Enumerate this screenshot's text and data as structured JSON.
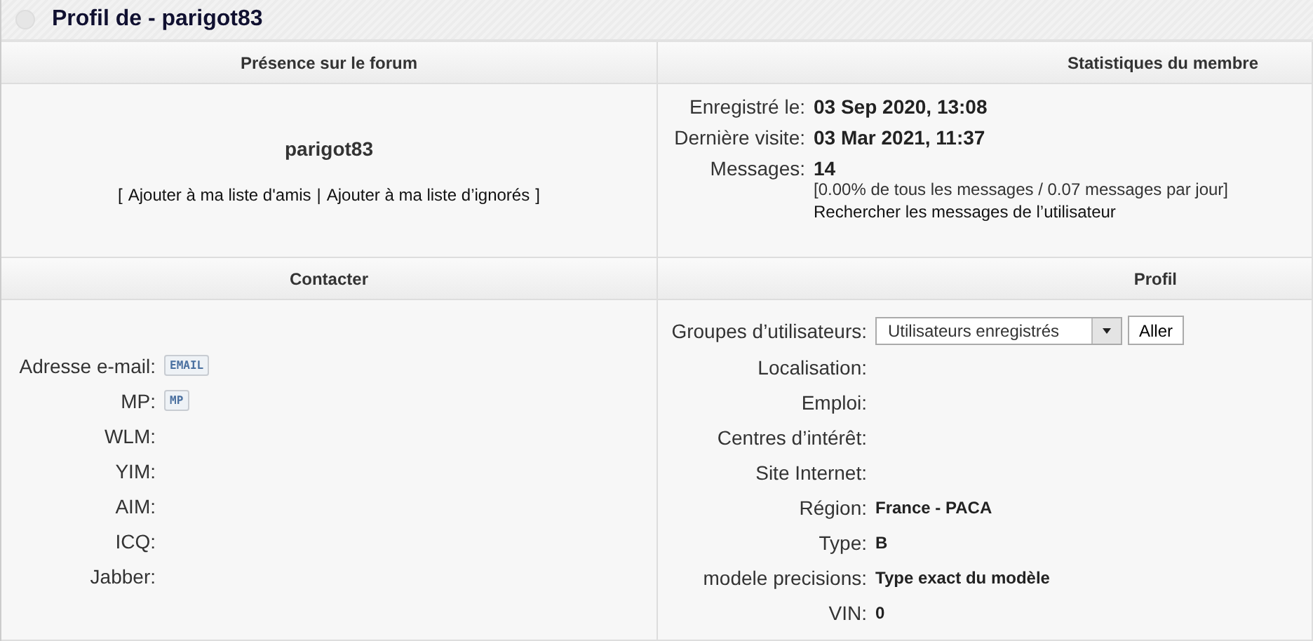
{
  "title": "Profil de - parigot83",
  "presence": {
    "heading": "Présence sur le forum",
    "username": "parigot83",
    "open_bracket": "[",
    "links": [
      "Ajouter à ma liste d'amis",
      "Ajouter à ma liste d’ignorés"
    ],
    "separator": "|",
    "close_bracket": "]"
  },
  "stats": {
    "heading": "Statistiques du membre",
    "rows": [
      {
        "label": "Enregistré le:",
        "value": "03 Sep 2020, 13:08"
      },
      {
        "label": "Dernière visite:",
        "value": "03 Mar 2021, 11:37"
      },
      {
        "label": "Messages:",
        "value": "14"
      }
    ],
    "note": "[0.00% de tous les messages / 0.07 messages par jour]",
    "search_link": "Rechercher les messages de l’utilisateur"
  },
  "contact": {
    "heading": "Contacter",
    "rows": [
      {
        "label": "Adresse e-mail:",
        "badge": "EMAIL"
      },
      {
        "label": "MP:",
        "badge": "MP"
      },
      {
        "label": "WLM:"
      },
      {
        "label": "YIM:"
      },
      {
        "label": "AIM:"
      },
      {
        "label": "ICQ:"
      },
      {
        "label": "Jabber:"
      }
    ]
  },
  "profile": {
    "heading": "Profil",
    "groups": {
      "label": "Groupes d’utilisateurs:",
      "value": "Utilisateurs enregistrés",
      "button": "Aller"
    },
    "rows": [
      {
        "label": "Localisation:"
      },
      {
        "label": "Emploi:"
      },
      {
        "label": "Centres d’intérêt:"
      },
      {
        "label": "Site Internet:"
      },
      {
        "label": "Région:",
        "value": "France - PACA"
      },
      {
        "label": "Type:",
        "value": "B"
      },
      {
        "label": "modele precisions:",
        "value": "Type exact du modèle"
      },
      {
        "label": "VIN:",
        "value": "0"
      }
    ]
  }
}
